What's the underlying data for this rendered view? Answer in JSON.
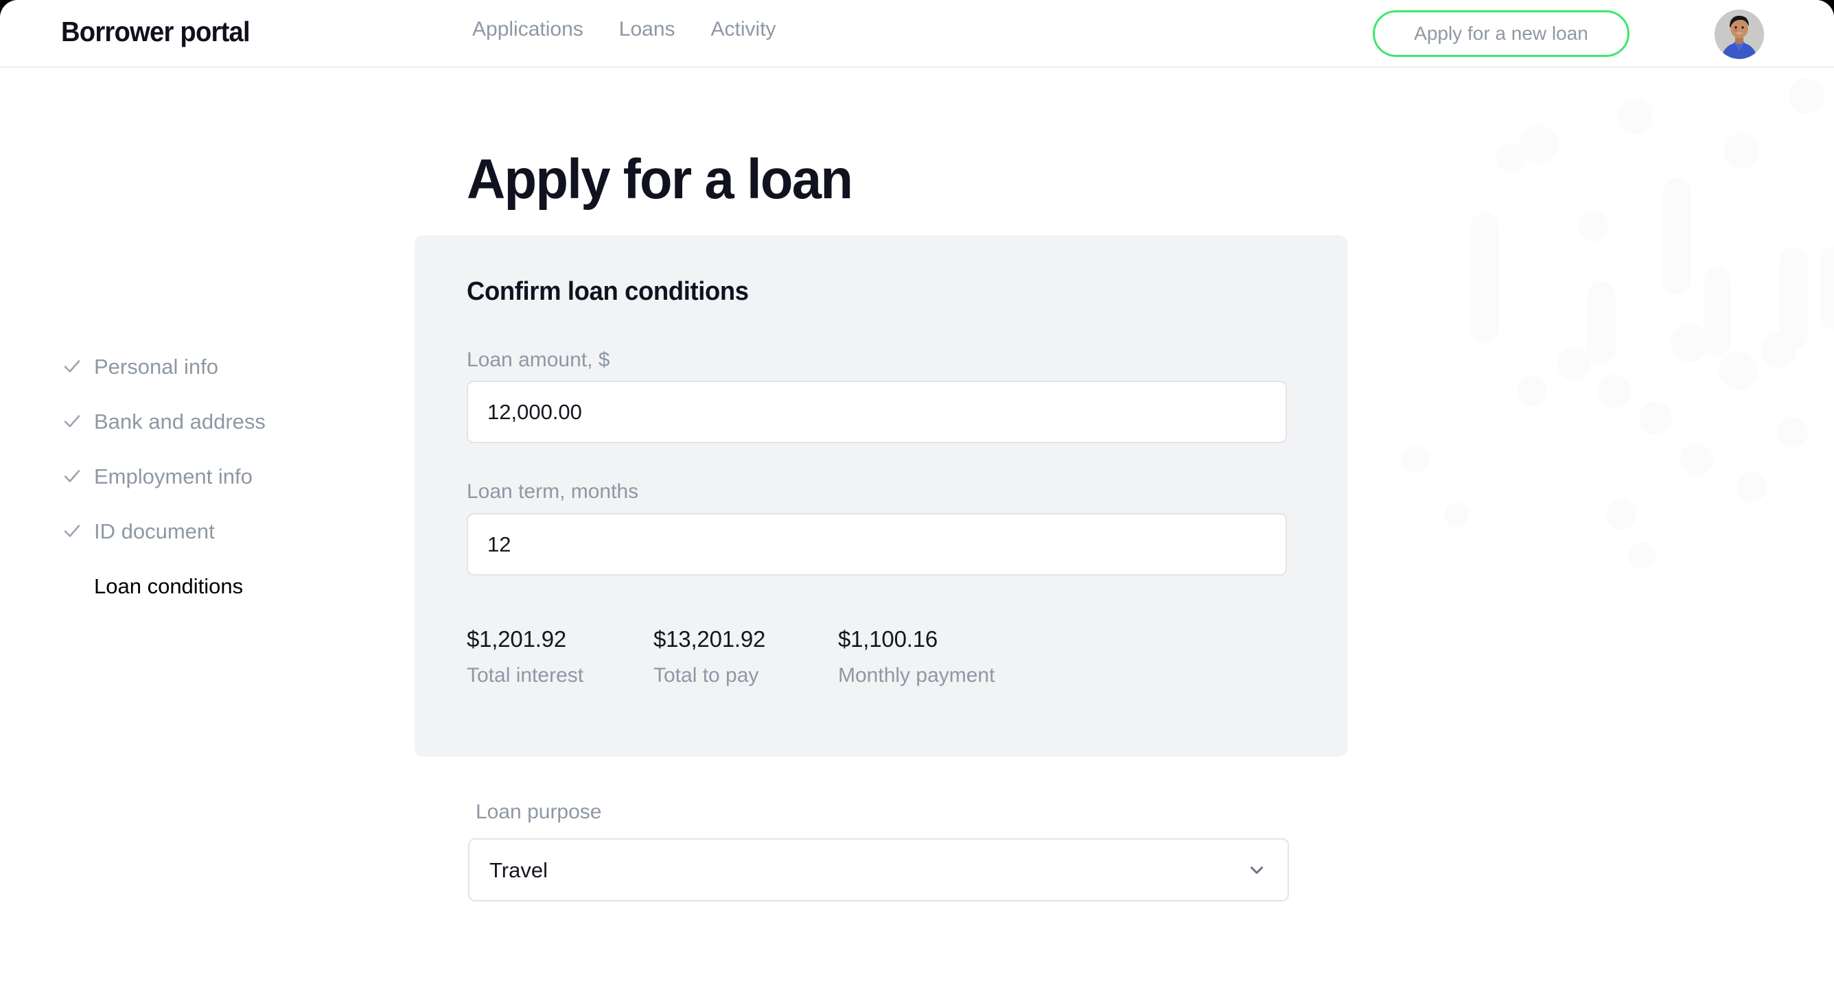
{
  "header": {
    "brand": "Borrower portal",
    "nav": [
      {
        "label": "Applications",
        "name": "nav-applications"
      },
      {
        "label": "Loans",
        "name": "nav-loans"
      },
      {
        "label": "Activity",
        "name": "nav-activity"
      }
    ],
    "cta_label": "Apply for a new loan",
    "cta_border_color": "#3ce86b",
    "avatar_alt": "user-avatar"
  },
  "page": {
    "title": "Apply for a loan"
  },
  "steps": [
    {
      "label": "Personal info",
      "completed": true
    },
    {
      "label": "Bank and address",
      "completed": true
    },
    {
      "label": "Employment info",
      "completed": true
    },
    {
      "label": "ID document",
      "completed": true
    },
    {
      "label": "Loan conditions",
      "completed": false,
      "active": true
    }
  ],
  "card": {
    "title": "Confirm loan conditions",
    "background": "#f2f3f5",
    "fields": {
      "amount": {
        "label": "Loan amount, $",
        "value": "12,000.00",
        "placeholder": "0.00"
      },
      "term": {
        "label": "Loan term, months",
        "value": "12",
        "placeholder": "0"
      }
    },
    "summary": [
      {
        "value": "$1,201.92",
        "label": "Total interest"
      },
      {
        "value": "$13,201.92",
        "label": "Total to pay"
      },
      {
        "value": "$1,100.16",
        "label": "Monthly payment"
      }
    ]
  },
  "purpose": {
    "label": "Loan purpose",
    "value": "Travel",
    "icon": "chevron-down-icon"
  },
  "colors": {
    "accent_green": "#3ce86b",
    "text_dark": "#11121f",
    "text_muted": "#8e98a4",
    "card_bg": "#f2f3f5",
    "input_border": "#e2e4e8"
  }
}
